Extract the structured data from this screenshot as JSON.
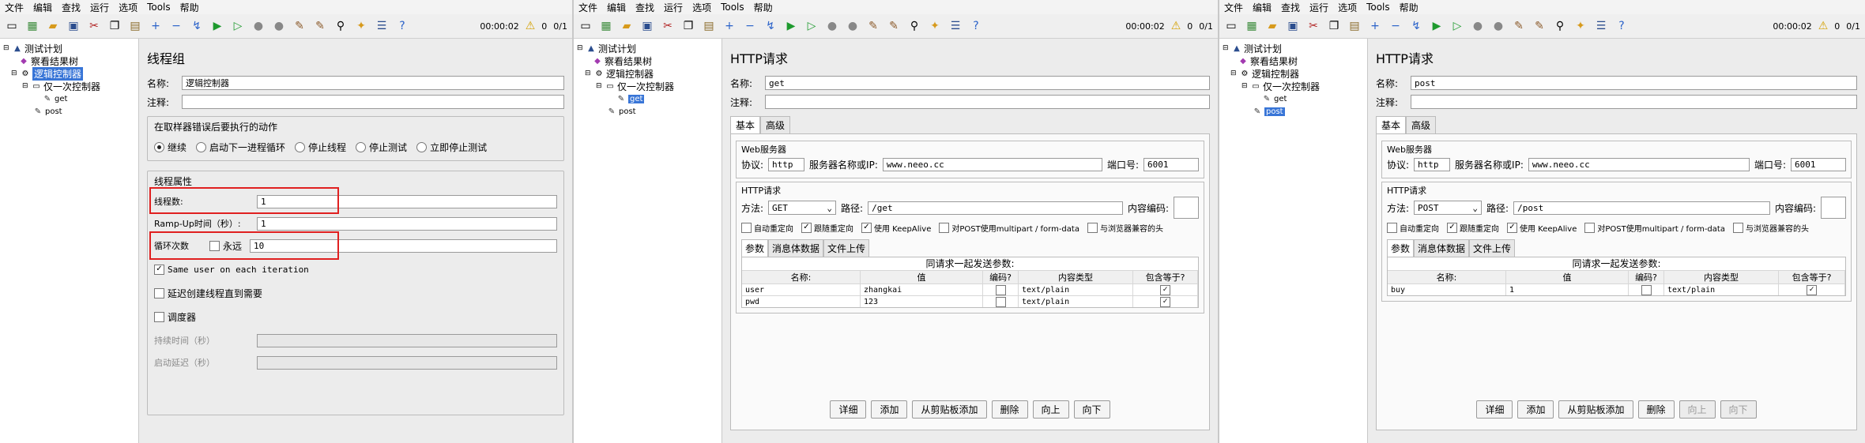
{
  "menu": [
    "文件",
    "编辑",
    "查找",
    "运行",
    "选项",
    "Tools",
    "帮助"
  ],
  "status": {
    "timer": "00:00:02",
    "warnings": "0",
    "threads": "0/1"
  },
  "tree": [
    {
      "label": "测试计划",
      "depth": 0
    },
    {
      "label": "察看结果树",
      "depth": 1
    },
    {
      "label": "逻辑控制器",
      "depth": 1
    },
    {
      "label": "仅一次控制器",
      "depth": 2
    },
    {
      "label": "get",
      "depth": 3
    },
    {
      "label": "post",
      "depth": 2
    }
  ],
  "thread_group": {
    "title": "线程组",
    "name_label": "名称:",
    "name_value": "逻辑控制器",
    "comment_label": "注释:",
    "error_group": "在取样器错误后要执行的动作",
    "error_actions": [
      "继续",
      "启动下一进程循环",
      "停止线程",
      "停止测试",
      "立即停止测试"
    ],
    "props_group": "线程属性",
    "threads_label": "线程数:",
    "threads_value": "1",
    "rampup_label": "Ramp-Up时间（秒）:",
    "rampup_value": "1",
    "loop_label": "循环次数",
    "forever_label": "永远",
    "loop_value": "10",
    "same_user": "Same user on each iteration",
    "delay_create": "延迟创建线程直到需要",
    "scheduler": "调度器",
    "duration_label": "持续时间（秒）",
    "startup_delay_label": "启动延迟（秒）"
  },
  "http_common": {
    "title": "HTTP请求",
    "name_label": "名称:",
    "comment_label": "注释:",
    "tab_basic": "基本",
    "tab_advanced": "高级",
    "web_server": "Web服务器",
    "protocol_label": "协议:",
    "protocol_value": "http",
    "server_label": "服务器名称或IP:",
    "server_value": "www.neeo.cc",
    "port_label": "端口号:",
    "port_value": "6001",
    "http_request": "HTTP请求",
    "method_label": "方法:",
    "path_label": "路径:",
    "encoding_label": "内容编码:",
    "opt_redirect_auto": "自动重定向",
    "opt_follow_redirect": "跟随重定向",
    "opt_keepalive": "使用 KeepAlive",
    "opt_multipart": "对POST使用multipart / form-data",
    "opt_browser_headers": "与浏览器兼容的头",
    "subtab_params": "参数",
    "subtab_body": "消息体数据",
    "subtab_files": "文件上传",
    "table_caption": "同请求一起发送参数:",
    "col_name": "名称:",
    "col_value": "值",
    "col_encode": "编码?",
    "col_type": "内容类型",
    "col_include": "包含等于?",
    "btn_detail": "详细",
    "btn_add": "添加",
    "btn_paste": "从剪贴板添加",
    "btn_delete": "删除",
    "btn_up": "向上",
    "btn_down": "向下"
  },
  "get_request": {
    "name_value": "get",
    "method": "GET",
    "path": "/get",
    "params": [
      {
        "name": "user",
        "value": "zhangkai",
        "type": "text/plain"
      },
      {
        "name": "pwd",
        "value": "123",
        "type": "text/plain"
      }
    ]
  },
  "post_request": {
    "name_value": "post",
    "method": "POST",
    "path": "/post",
    "params": [
      {
        "name": "buy",
        "value": "1",
        "type": "text/plain"
      }
    ]
  }
}
